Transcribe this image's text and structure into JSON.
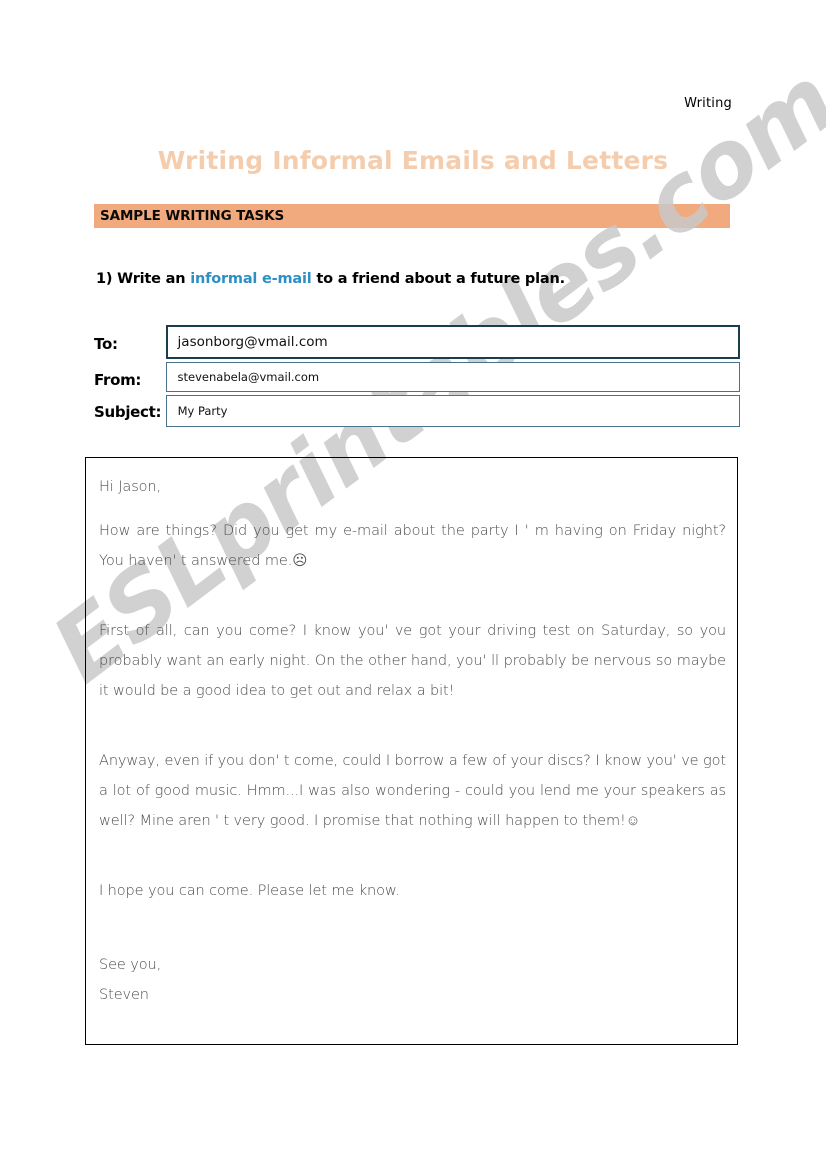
{
  "header": {
    "running_head": "Writing"
  },
  "title": {
    "text": "Writing Informal Emails and Letters",
    "color": "#f4cdae"
  },
  "section_bar": {
    "label": "SAMPLE WRITING TASKS",
    "background": "#f0aa7d"
  },
  "task": {
    "number": "1) Write an ",
    "highlight": "informal e-mail",
    "highlight_color": "#2e8fc4",
    "rest": " to a friend about a future plan."
  },
  "mail_fields": {
    "to": {
      "label": "To:",
      "value": "jasonborg@vmail.com"
    },
    "from": {
      "label": "From:",
      "value": "stevenabela@vmail.com"
    },
    "subject": {
      "label": "Subject:",
      "value": "My Party"
    }
  },
  "letter": {
    "greeting": "Hi Jason,",
    "paragraph1": "How are things? Did you get my e-mail about the party I ' m having on Friday night? You haven' t answered me.☹",
    "paragraph2": "First of all, can you come? I know you' ve got your driving test on Saturday, so you probably want an early night. On the other hand, you' ll probably be nervous so maybe it would be a good idea to get out and relax a bit!",
    "paragraph3": "Anyway, even if you don' t come, could I borrow a few of your discs? I know you' ve got a lot of good music. Hmm...I was also wondering - could you lend me your speakers as well? Mine aren ' t very good. I promise that nothing will happen to them!☺",
    "paragraph4": "I hope you can come. Please let me know.",
    "signoff": "See you,",
    "signature": "Steven"
  },
  "watermark": {
    "text": "ESLprintables.com",
    "color": "#c9c9c9"
  }
}
